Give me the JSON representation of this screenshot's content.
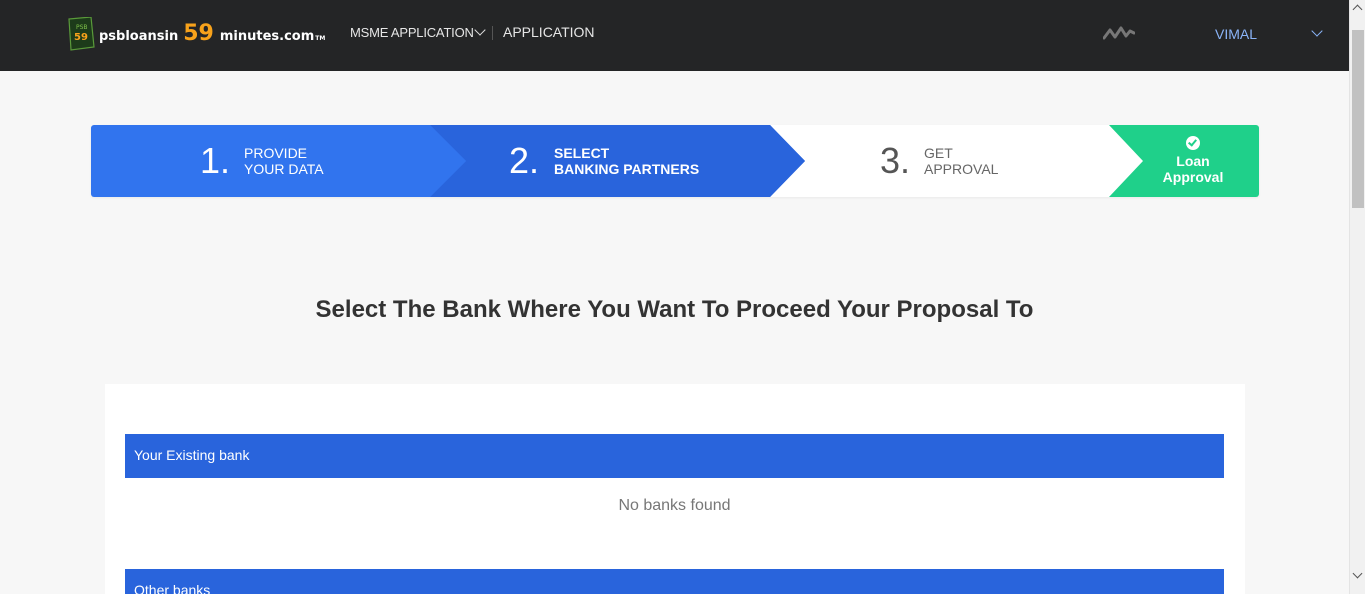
{
  "header": {
    "logo": {
      "badge_top": "PSB",
      "badge_num": "59",
      "text_left": "psbloansin",
      "text_num": "59",
      "text_right": "minutes.com",
      "tm": "TM"
    },
    "nav": {
      "msme_label": "MSME APPLICATION",
      "application_label": "APPLICATION"
    },
    "user": {
      "name": "VIMAL"
    },
    "colors": {
      "bg": "#242526",
      "accent": "#f7a21b",
      "user": "#8ab4f8"
    }
  },
  "stepper": {
    "steps": [
      {
        "num": "1.",
        "line1": "PROVIDE",
        "line2": "YOUR DATA"
      },
      {
        "num": "2.",
        "line1": "SELECT",
        "line2": "BANKING PARTNERS"
      },
      {
        "num": "3.",
        "line1": "GET",
        "line2": "APPROVAL"
      }
    ],
    "final": {
      "line1": "Loan",
      "line2": "Approval",
      "icon": "check-circle-icon"
    },
    "colors": {
      "step1": "#3174ee",
      "step2": "#2964dc",
      "final": "#1fd08a"
    }
  },
  "main": {
    "title": "Select The Bank Where You Want To Proceed Your Proposal To",
    "existing_bank_header": "Your Existing bank",
    "no_banks_text": "No banks found",
    "other_banks_header": "Other banks"
  }
}
